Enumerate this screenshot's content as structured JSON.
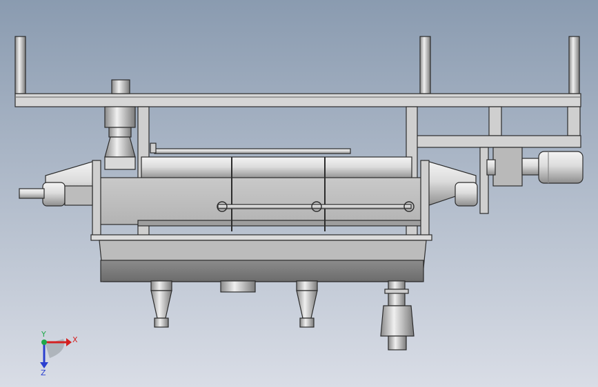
{
  "viewport": {
    "background_top": "#8a9bb0",
    "background_bottom": "#d9dde6"
  },
  "model": {
    "metal_light": "#e2e2e2",
    "metal_mid": "#bdbdbd",
    "metal_dark": "#6d6d6d",
    "edge": "#2b2b2b"
  },
  "triad": {
    "x_label": "X",
    "y_label": "Y",
    "z_label": "Z",
    "x_color": "#d42020",
    "y_color": "#1fa84a",
    "z_color": "#2a3fcf"
  }
}
